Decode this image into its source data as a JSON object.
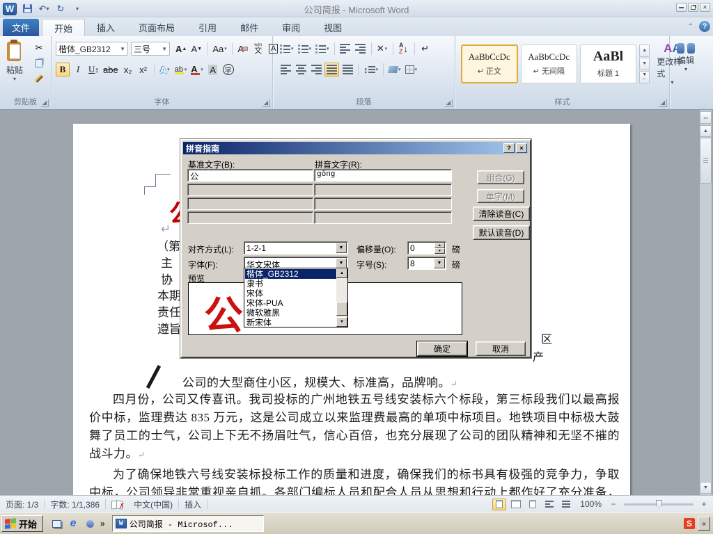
{
  "window": {
    "title": "公司简报 - Microsoft Word"
  },
  "tabs": {
    "file": "文件",
    "items": [
      "开始",
      "插入",
      "页面布局",
      "引用",
      "邮件",
      "审阅",
      "视图"
    ],
    "active": "开始"
  },
  "ribbon": {
    "clipboard": {
      "label": "剪贴板",
      "paste": "粘贴"
    },
    "font": {
      "label": "字体",
      "name": "楷体_GB2312",
      "size": "三号",
      "bold": "B",
      "italic": "I",
      "underline": "U",
      "strike": "abe",
      "subscript": "x₂",
      "superscript": "x²",
      "grow": "A",
      "shrink": "A",
      "change_case": "Aa",
      "clear": "A",
      "phonetic_top": "wén",
      "phonetic": "文",
      "char_border": "A",
      "text_effects": "A",
      "highlight": "ab",
      "font_color": "A",
      "char_shading": "A",
      "enclose": "字"
    },
    "paragraph": {
      "label": "段落",
      "sort_a": "A",
      "sort_z": "Z",
      "marks": "↵"
    },
    "styles": {
      "label": "样式",
      "cards": [
        {
          "sample": "AaBbCcDc",
          "name": "↵ 正文"
        },
        {
          "sample": "AaBbCcDc",
          "name": "↵ 无间隔"
        },
        {
          "sample": "AaBl",
          "name": "标题 1"
        }
      ],
      "change": "更改样式"
    },
    "editing": {
      "label": "编辑"
    }
  },
  "dialog": {
    "title": "拼音指南",
    "base_label": "基准文字(B):",
    "ruby_label": "拼音文字(R):",
    "base_value": "公",
    "ruby_value": "gōng",
    "combine": "组合(G)",
    "mono": "单字(M)",
    "clear": "清除读音(C)",
    "default": "默认读音(D)",
    "alignment_label": "对齐方式(L):",
    "alignment_value": "1-2-1",
    "offset_label": "偏移量(O):",
    "offset_value": "0",
    "offset_unit": "磅",
    "font_label": "字体(F):",
    "font_value": "华文宋体",
    "size_label": "字号(S):",
    "size_value": "8",
    "size_unit": "磅",
    "preview_label": "预览",
    "preview_char": "公",
    "ok": "确定",
    "cancel": "取消",
    "help_btn": "?",
    "close_btn": "×",
    "font_list": [
      "楷体_GB2312",
      "隶书",
      "宋体",
      "宋体-PUA",
      "微软雅黑",
      "新宋体"
    ],
    "font_list_selected": "楷体_GB2312"
  },
  "document": {
    "masthead_char": "公",
    "pilcrow": "↵",
    "left_lines": [
      "（第",
      "主",
      "协",
      "本期",
      "责任",
      "遵旨"
    ],
    "right_lines": [
      "区",
      "产"
    ],
    "line1": "公司的大型商住小区，规模大、标准高，品牌响。",
    "para1": "四月份，公司又传喜讯。我司投标的广州地铁五号线安装标六个标段，第三标段我们以最高报价中标，监理费达 835 万元，这是公司成立以来监理费最高的单项中标项目。地铁项目中标极大鼓舞了员工的士气，公司上下无不扬眉吐气，信心百倍，也充分展现了公司的团队精神和无坚不摧的战斗力。",
    "para2": "为了确保地铁六号线安装标投标工作的质量和进度，确保我们的标书具有极强的竞争力，争取中标，公司领导非常重视亲自抓。各部门编标人员和配合人员从思想和行动上都作好了充分准备，憋足了劲，要为地铁六号线安装标投标工作大干一场，贡献力量。经营部投标时，人手少，任务重，按甲方要求，地铁六号线安装标六个标段都要投，要编制六套投标文件"
  },
  "statusbar": {
    "page": "页面: 1/3",
    "words": "字数: 1/1,386",
    "language": "中文(中国)",
    "mode": "插入",
    "zoom": "100%"
  },
  "taskbar": {
    "start": "开始",
    "task": "公司简报 - Microsof...",
    "tray_s": "S",
    "expand": "«"
  },
  "colors": {
    "masthead_red": "#C00000",
    "selection_navy": "#0A246A",
    "ribbon_highlight": "#FBD77E",
    "file_tab_blue": "#2B579A"
  }
}
